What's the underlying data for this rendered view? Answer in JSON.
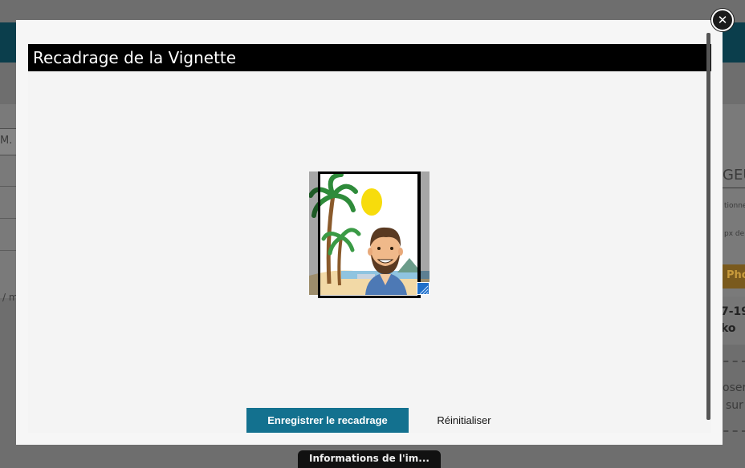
{
  "background": {
    "left_text": "M.",
    "left_text2": "/ m",
    "right_heading": "GEU",
    "right_small1": "tionne",
    "right_small2": "px de",
    "right_button": "Pho",
    "right_date": "7-19",
    "right_name": "ko",
    "right_text1": "oser",
    "right_text2": "sur",
    "bottom_tab": "Informations de l'im..."
  },
  "modal": {
    "title": "Recadrage de la Vignette",
    "save_label": "Enregistrer le recadrage",
    "reset_label": "Réinitialiser"
  }
}
